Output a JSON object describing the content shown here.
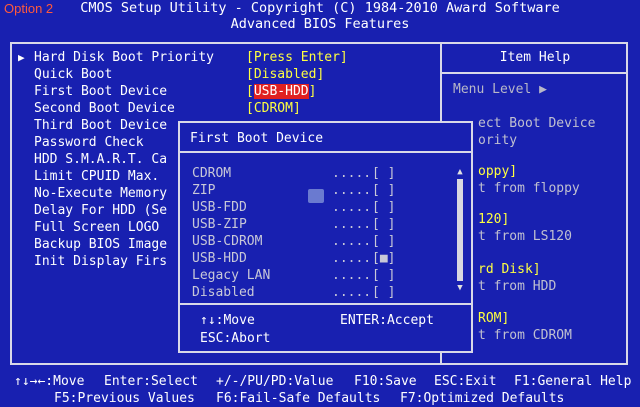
{
  "overlay_label": "Option 2",
  "header": {
    "line1": "CMOS Setup Utility - Copyright (C) 1984-2010 Award Software",
    "line2": "Advanced BIOS Features"
  },
  "settings": [
    {
      "label": "Hard Disk Boot Priority",
      "value": "[Press Enter]",
      "has_arrow": true
    },
    {
      "label": "Quick Boot",
      "value": "[Disabled]"
    },
    {
      "label": "First Boot Device",
      "value": "USB-HDD",
      "highlighted": true
    },
    {
      "label": "Second Boot Device",
      "value": "[CDROM]"
    },
    {
      "label": "Third Boot Device",
      "value": ""
    },
    {
      "label": "Password Check",
      "value": ""
    },
    {
      "label": "HDD S.M.A.R.T. Ca",
      "value": ""
    },
    {
      "label": "Limit CPUID Max.",
      "value": ""
    },
    {
      "label": "No-Execute Memory",
      "value": ""
    },
    {
      "label": "Delay For HDD (Se",
      "value": ""
    },
    {
      "label": "Full Screen LOGO",
      "value": ""
    },
    {
      "label": "Backup BIOS Image",
      "value": ""
    },
    {
      "label": "Init Display Firs",
      "value": ""
    }
  ],
  "first_boot_value_brackets": {
    "open": "[",
    "close": "]"
  },
  "help": {
    "title": "Item Help",
    "menu_level": "Menu Level   ▶",
    "lines": [
      {
        "text": "ect Boot Device",
        "style": "dim"
      },
      {
        "text": "ority",
        "style": "dim"
      },
      {
        "text": "oppy]",
        "style": "yel"
      },
      {
        "text": "t from floppy",
        "style": "dim"
      },
      {
        "text": "120]",
        "style": "yel"
      },
      {
        "text": "t from LS120",
        "style": "dim"
      },
      {
        "text": "rd Disk]",
        "style": "yel"
      },
      {
        "text": "t from HDD",
        "style": "dim"
      },
      {
        "text": "ROM]",
        "style": "yel"
      },
      {
        "text": "t from CDROM",
        "style": "dim"
      }
    ]
  },
  "popup": {
    "title": "First Boot Device",
    "options": [
      {
        "name": "CDROM",
        "dots": ".....",
        "mark": "[ ]"
      },
      {
        "name": "ZIP",
        "dots": ".....",
        "mark": "[ ]"
      },
      {
        "name": "USB-FDD",
        "dots": ".....",
        "mark": "[ ]"
      },
      {
        "name": "USB-ZIP",
        "dots": ".....",
        "mark": "[ ]"
      },
      {
        "name": "USB-CDROM",
        "dots": ".....",
        "mark": "[ ]"
      },
      {
        "name": "USB-HDD",
        "dots": ".....",
        "mark": "[■]"
      },
      {
        "name": "Legacy LAN",
        "dots": ".....",
        "mark": "[ ]"
      },
      {
        "name": "Disabled",
        "dots": ".....",
        "mark": "[ ]"
      }
    ],
    "hint_move": "↑↓:Move",
    "hint_accept": "ENTER:Accept",
    "hint_abort": "ESC:Abort"
  },
  "footer": {
    "line1": [
      "↑↓→←:Move",
      "Enter:Select",
      "+/-/PU/PD:Value",
      "F10:Save",
      "ESC:Exit",
      "F1:General Help"
    ],
    "line2": [
      "F5:Previous Values",
      "F6:Fail-Safe Defaults",
      "F7:Optimized Defaults"
    ]
  },
  "colors": {
    "background": "#1820b0",
    "value_yellow": "#ffff40",
    "highlight_red": "#e02020",
    "overlay_orange": "#ff5a3c"
  }
}
